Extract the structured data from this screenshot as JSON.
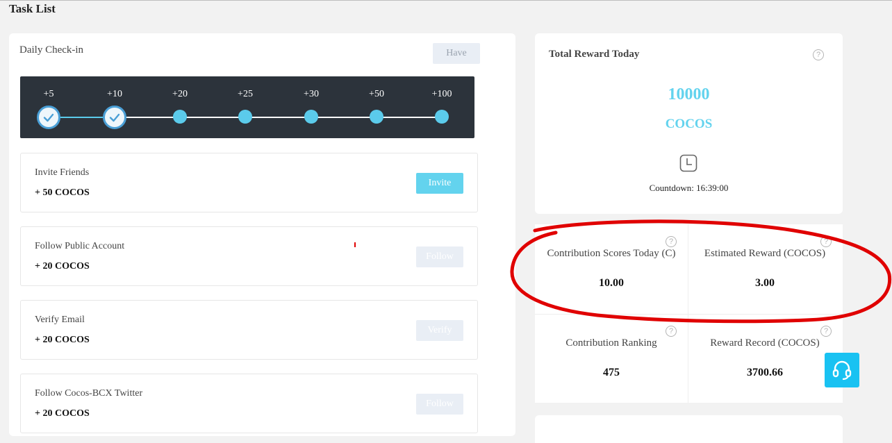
{
  "page": {
    "title": "Task List"
  },
  "checkin": {
    "title": "Daily Check-in",
    "button_label": "Have",
    "steps": [
      {
        "label": "+5",
        "done": true
      },
      {
        "label": "+10",
        "done": true
      },
      {
        "label": "+20",
        "done": false
      },
      {
        "label": "+25",
        "done": false
      },
      {
        "label": "+30",
        "done": false
      },
      {
        "label": "+50",
        "done": false
      },
      {
        "label": "+100",
        "done": false
      }
    ]
  },
  "tasks": [
    {
      "name": "Invite Friends",
      "reward": "+ 50 COCOS",
      "button": "Invite",
      "enabled": true
    },
    {
      "name": "Follow Public Account",
      "reward": "+ 20 COCOS",
      "button": "Follow",
      "enabled": false
    },
    {
      "name": "Verify Email",
      "reward": "+ 20 COCOS",
      "button": "Verify",
      "enabled": false
    },
    {
      "name": "Follow Cocos-BCX Twitter",
      "reward": "+ 20 COCOS",
      "button": "Follow",
      "enabled": false
    }
  ],
  "reward": {
    "title": "Total Reward Today",
    "amount": "10000",
    "unit": "COCOS",
    "countdown": "Countdown: 16:39:00"
  },
  "stats": [
    {
      "label": "Contribution Scores Today (C)",
      "value": "10.00"
    },
    {
      "label": "Estimated Reward (COCOS)",
      "value": "3.00"
    },
    {
      "label": "Contribution Ranking",
      "value": "475"
    },
    {
      "label": "Reward Record (COCOS)",
      "value": "3700.66"
    }
  ],
  "colors": {
    "accent": "#63d3ee",
    "track_bg": "#2c333b",
    "support_button": "#19c2f2",
    "annotation": "#e00000"
  },
  "icons": {
    "help": "help-circle-icon",
    "clock": "clock-icon",
    "support": "headset-icon",
    "check": "checkmark-icon"
  }
}
